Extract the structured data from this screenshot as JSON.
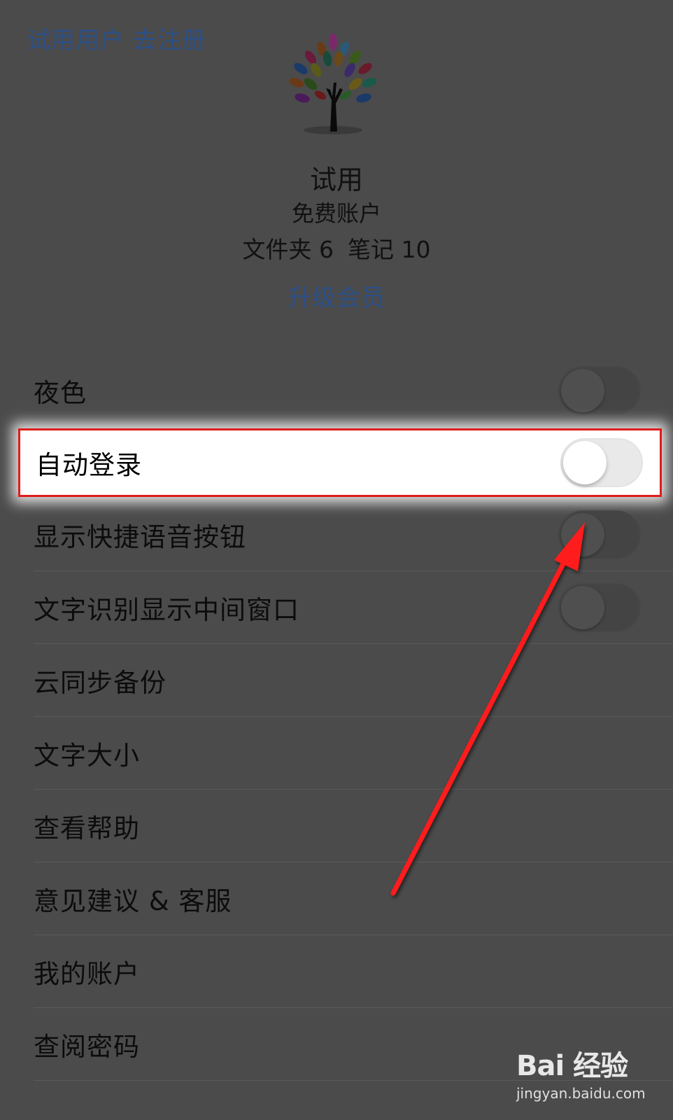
{
  "header": {
    "trial_link": "试用用户 去注册"
  },
  "profile": {
    "name": "试用",
    "plan": "免费账户",
    "folders_text": "文件夹 6",
    "notes_text": "笔记 10",
    "upgrade_link": "升级会员"
  },
  "settings": [
    {
      "label": "夜色",
      "toggle": "off"
    },
    {
      "label": "自动登录",
      "toggle": "off"
    },
    {
      "label": "显示快捷语音按钮",
      "toggle": "off"
    },
    {
      "label": "文字识别显示中间窗口",
      "toggle": "off"
    },
    {
      "label": "云同步备份"
    },
    {
      "label": "文字大小"
    },
    {
      "label": "查看帮助"
    },
    {
      "label": "意见建议 & 客服"
    },
    {
      "label": "我的账户"
    },
    {
      "label": "查阅密码"
    }
  ],
  "watermark": {
    "brand": "Bai 经验",
    "url": "jingyan.baidu.com"
  },
  "colors": {
    "link": "#2b4f87",
    "overlay_bg": "#4b4b4b",
    "highlight_border": "#e01b1b",
    "arrow": "#ff1a1a"
  }
}
